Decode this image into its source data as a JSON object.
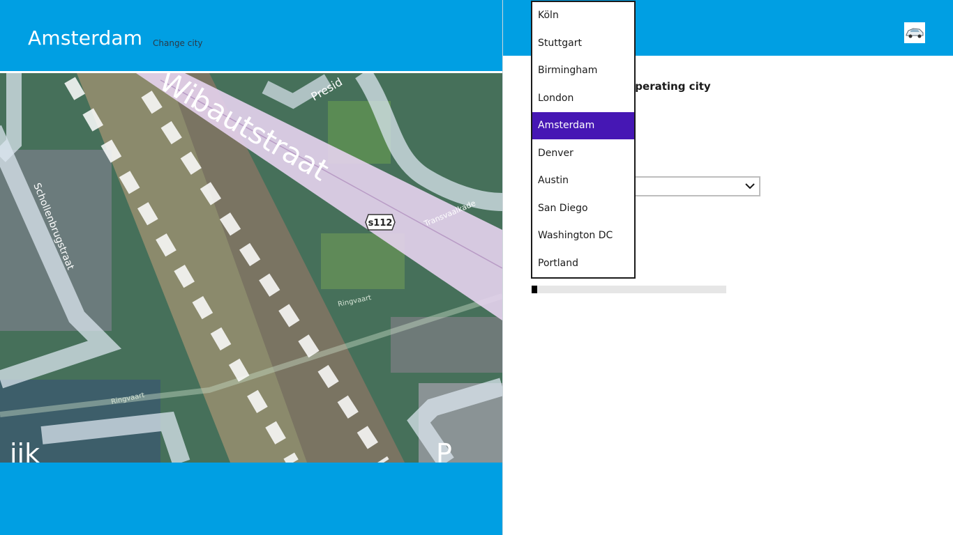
{
  "header": {
    "city_title": "Amsterdam",
    "change_city_label": "Change city"
  },
  "map": {
    "labels": {
      "street_main": "Wibautstraat",
      "street_side": "Schollenbrugstraat",
      "road_shield": "s112",
      "transvaalkade": "Transvaalkade",
      "ringvaart_1": "Ringvaart",
      "ringvaart_2": "Ringvaart",
      "president": "Presid",
      "fragment_left": "ijk",
      "fragment_right": "P"
    }
  },
  "settings": {
    "heading_fragment": "operating city",
    "select_value_fragment": ")",
    "progress_fraction": 0.03
  },
  "dropdown": {
    "items": [
      {
        "label": "Köln",
        "selected": false
      },
      {
        "label": "Stuttgart",
        "selected": false
      },
      {
        "label": "Birmingham",
        "selected": false
      },
      {
        "label": "London",
        "selected": false
      },
      {
        "label": "Amsterdam",
        "selected": true
      },
      {
        "label": "Denver",
        "selected": false
      },
      {
        "label": "Austin",
        "selected": false
      },
      {
        "label": "San Diego",
        "selected": false
      },
      {
        "label": "Washington DC",
        "selected": false
      },
      {
        "label": "Portland",
        "selected": false
      }
    ]
  },
  "colors": {
    "accent": "#009fe3",
    "selected_item": "#4617b4"
  },
  "icons": {
    "avatar": "car-icon",
    "select": "chevron-down-icon"
  }
}
